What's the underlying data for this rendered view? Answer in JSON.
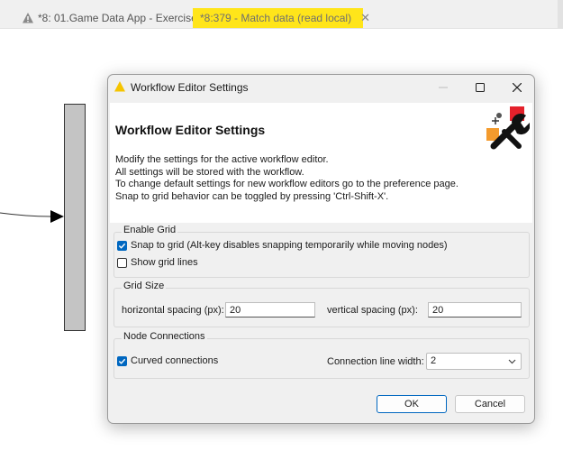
{
  "tabs": [
    {
      "label": "*8: 01.Game Data App - Exercise"
    },
    {
      "label": "*8:379 - Match data (read local)"
    }
  ],
  "dialog": {
    "window_title": "Workflow Editor Settings",
    "header_title": "Workflow Editor Settings",
    "description": [
      "Modify the settings for the active workflow editor.",
      "All settings will be stored with the workflow.",
      "To change default settings for new workflow editors go to the preference page.",
      "Snap to grid behavior can be toggled by pressing 'Ctrl-Shift-X'."
    ],
    "enable_grid": {
      "legend": "Enable Grid",
      "snap_to_grid": {
        "label": "Snap to grid (Alt-key disables snapping temporarily while moving nodes)",
        "checked": true
      },
      "show_grid_lines": {
        "label": "Show grid lines",
        "checked": false
      }
    },
    "grid_size": {
      "legend": "Grid Size",
      "horizontal_label": "horizontal spacing (px):",
      "horizontal_value": "20",
      "vertical_label": "vertical spacing (px):",
      "vertical_value": "20"
    },
    "node_connections": {
      "legend": "Node Connections",
      "curved": {
        "label": "Curved connections",
        "checked": true
      },
      "line_width_label": "Connection line width:",
      "line_width_value": "2"
    },
    "ok_label": "OK",
    "cancel_label": "Cancel"
  },
  "colors": {
    "active_tab": "#ffe51a",
    "accent": "#0067c0",
    "node_fill": "#c4c4c4"
  }
}
